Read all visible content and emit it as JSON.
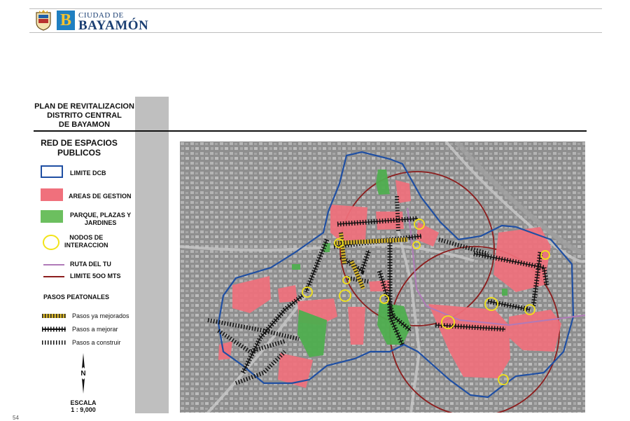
{
  "header": {
    "city_small": "CIUDAD DE",
    "city_big": "BAYAMÓN",
    "logo_letter": "B"
  },
  "plan": {
    "title_lines": [
      "PLAN DE REVITALIZACION",
      "DISTRITO CENTRAL",
      "DE BAYAMON"
    ]
  },
  "legend": {
    "heading_lines": [
      "RED DE ESPACIOS",
      "PUBLICOS"
    ],
    "items": [
      {
        "key": "limite_dcb",
        "label": "LIMITE DCB",
        "color": "#1f4fa3"
      },
      {
        "key": "areas_gestion",
        "label": "AREAS DE GESTION",
        "color": "#f0707c"
      },
      {
        "key": "parques",
        "label_lines": [
          "PARQUE, PLAZAS Y",
          "JARDINES"
        ],
        "color": "#5cb85c"
      },
      {
        "key": "nodos",
        "label_lines": [
          "NODOS DE",
          "INTERACCION"
        ],
        "color": "#f2e318"
      },
      {
        "key": "ruta_tu",
        "label": "RUTA DEL TU",
        "color": "#b07ab8"
      },
      {
        "key": "limite_500",
        "label": "LIMITE 5OO MTS",
        "color": "#8c1d1d"
      }
    ],
    "pasos_heading": "PASOS PEATONALES",
    "pasos": [
      {
        "key": "mejorados",
        "label": "Pasos ya mejorados",
        "color": "#d4b32a"
      },
      {
        "key": "a_mejorar",
        "label": "Pasos a mejorar",
        "color": "#111111"
      },
      {
        "key": "a_construir",
        "label": "Pasos a construir",
        "color": "#111111"
      }
    ],
    "north_label": "N",
    "scale_label": "ESCALA",
    "scale_value": "1 : 9,000"
  },
  "page_number": "54",
  "map": {
    "colors": {
      "base": "#8d8d8d",
      "gestion": "#f0707c",
      "park": "#4fae4f",
      "dcb": "#1f4fa3",
      "circle": "#8c1d1d",
      "tu": "#b07ab8",
      "node": "#f2e318"
    }
  }
}
